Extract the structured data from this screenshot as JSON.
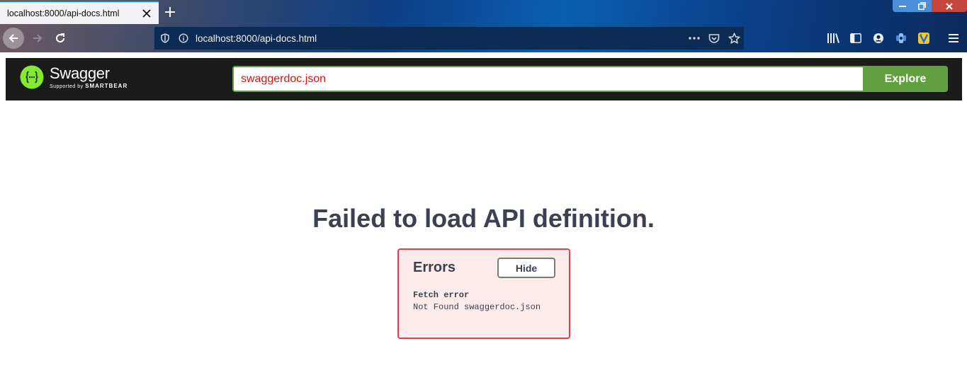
{
  "browser": {
    "tab_title": "localhost:8000/api-docs.html",
    "url": "localhost:8000/api-docs.html",
    "icons": {
      "tab_close": "close-icon",
      "new_tab": "plus-icon",
      "back": "arrow-left-icon",
      "forward": "arrow-right-icon",
      "reload": "reload-icon",
      "tracking": "shield-icon",
      "site_info": "info-icon",
      "page_actions": "ellipsis-icon",
      "pocket": "pocket-icon",
      "bookmark": "star-icon",
      "library": "library-icon",
      "sidebar": "sidebar-icon",
      "account": "account-icon",
      "extension1": "puzzle-extension-icon",
      "extension2": "v-extension-icon",
      "menu": "hamburger-menu-icon"
    }
  },
  "swagger": {
    "logo_name": "Swagger",
    "logo_supported": "Supported by",
    "logo_brand": "SMARTBEAR",
    "spec_url": "swaggerdoc.json",
    "explore_label": "Explore"
  },
  "error_page": {
    "title": "Failed to load API definition.",
    "errors_heading": "Errors",
    "hide_label": "Hide",
    "error_type": "Fetch error",
    "error_message": "Not Found swaggerdoc.json"
  },
  "colors": {
    "swagger_green": "#62a03f",
    "topbar_bg": "#1b1b1b",
    "error_border": "#e04147",
    "error_bg": "#fdeaea",
    "input_text": "#dd1111"
  }
}
